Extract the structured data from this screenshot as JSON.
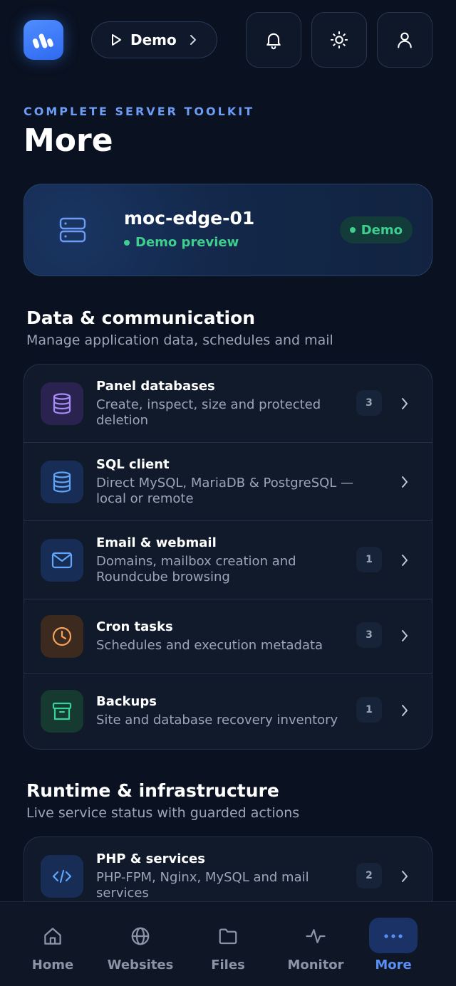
{
  "topbar": {
    "demo_label": "Demo",
    "icons": [
      "bell-icon",
      "sun-icon",
      "user-icon"
    ]
  },
  "header": {
    "eyebrow": "COMPLETE SERVER TOOLKIT",
    "title": "More"
  },
  "server": {
    "name": "moc-edge-01",
    "status": "Demo preview",
    "badge": "Demo"
  },
  "sections": [
    {
      "title": "Data & communication",
      "subtitle": "Manage application data, schedules and mail",
      "items": [
        {
          "title": "Panel databases",
          "desc": "Create, inspect, size and protected deletion",
          "count": "3",
          "icon": "database-icon"
        },
        {
          "title": "SQL client",
          "desc": "Direct MySQL, MariaDB & PostgreSQL — local or remote",
          "count": "",
          "icon": "database-icon"
        },
        {
          "title": "Email & webmail",
          "desc": "Domains, mailbox creation and Roundcube browsing",
          "count": "1",
          "icon": "mail-icon"
        },
        {
          "title": "Cron tasks",
          "desc": "Schedules and execution metadata",
          "count": "3",
          "icon": "clock-icon"
        },
        {
          "title": "Backups",
          "desc": "Site and database recovery inventory",
          "count": "1",
          "icon": "archive-icon"
        }
      ]
    },
    {
      "title": "Runtime & infrastructure",
      "subtitle": "Live service status with guarded actions",
      "items": [
        {
          "title": "PHP & services",
          "desc": "PHP-FPM, Nginx, MySQL and mail services",
          "count": "2",
          "icon": "code-icon"
        }
      ]
    }
  ],
  "nav": [
    {
      "label": "Home",
      "icon": "home-icon"
    },
    {
      "label": "Websites",
      "icon": "globe-icon"
    },
    {
      "label": "Files",
      "icon": "folder-icon"
    },
    {
      "label": "Monitor",
      "icon": "activity-icon"
    },
    {
      "label": "More",
      "icon": "more-icon",
      "active": true
    }
  ],
  "colors": {
    "accent": "#3b82f6",
    "success": "#3ecf8e",
    "background": "#0a1120"
  }
}
